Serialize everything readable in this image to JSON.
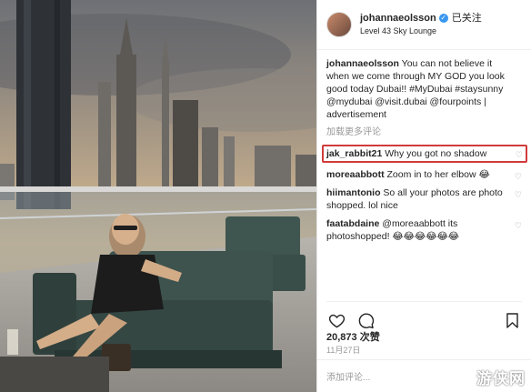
{
  "post": {
    "username": "johannaeolsson",
    "follow_label": "已关注",
    "location": "Level 43 Sky Lounge"
  },
  "caption": {
    "user": "johannaeolsson",
    "text": "You can not believe it when we come through MY GOD you look good today Dubai!! #MyDubai #staysunny @mydubai @visit.dubai @fourpoints | advertisement"
  },
  "load_more_label": "加载更多评论",
  "comments": [
    {
      "user": "jak_rabbit21",
      "text": "Why you got no shadow",
      "highlighted": true
    },
    {
      "user": "moreaabbott",
      "text": "Zoom in to her elbow 😂"
    },
    {
      "user": "hiimantonio",
      "text": "So all your photos are photo shopped. lol nice"
    },
    {
      "user": "faatabdaine",
      "text": "@moreaabbott its photoshopped! 😂😂😂😂😂😂"
    }
  ],
  "likes": "20,873 次赞",
  "date": "11月27日",
  "add_comment_placeholder": "添加评论...",
  "watermark": "游侠网",
  "icons": {
    "verified": "verified-badge-icon",
    "like": "heart-icon",
    "comment": "comment-bubble-icon",
    "bookmark": "bookmark-icon",
    "comment_like": "small-heart-icon"
  },
  "colors": {
    "highlight_border": "#d13b3b",
    "verified": "#3897f0"
  }
}
